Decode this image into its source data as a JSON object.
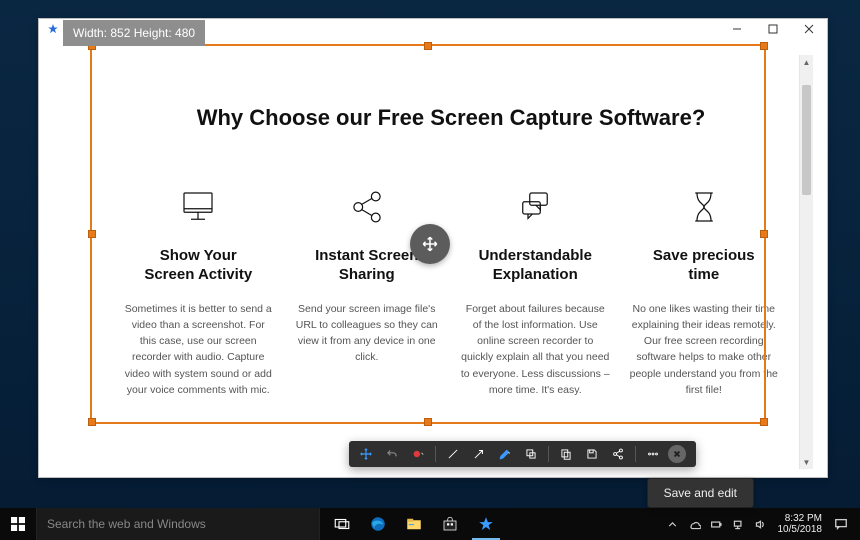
{
  "dim_label": "Width: 852 Height: 480",
  "headline": "Why Choose our Free Screen Capture Software?",
  "features": [
    {
      "title": "Show Your\nScreen Activity",
      "desc": "Sometimes it is better to send a video than a screenshot. For this case, use our screen recorder with audio. Capture video with system sound or add your voice comments with mic."
    },
    {
      "title": "Instant Screen\nSharing",
      "desc": "Send your screen image file's URL to colleagues so they can view it from any device in one click."
    },
    {
      "title": "Understandable\nExplanation",
      "desc": "Forget about failures because of the lost information. Use online screen recorder to quickly explain all that you need to everyone. Less discussions – more time. It's easy."
    },
    {
      "title": "Save precious\ntime",
      "desc": "No one likes wasting their time explaining their ideas remotely. Our free screen recording software helps to make other people understand you from the first file!"
    }
  ],
  "save_button": "Save and edit",
  "search_placeholder": "Search the web and Windows",
  "clock": {
    "time": "8:32 PM",
    "date": "10/5/2018"
  }
}
